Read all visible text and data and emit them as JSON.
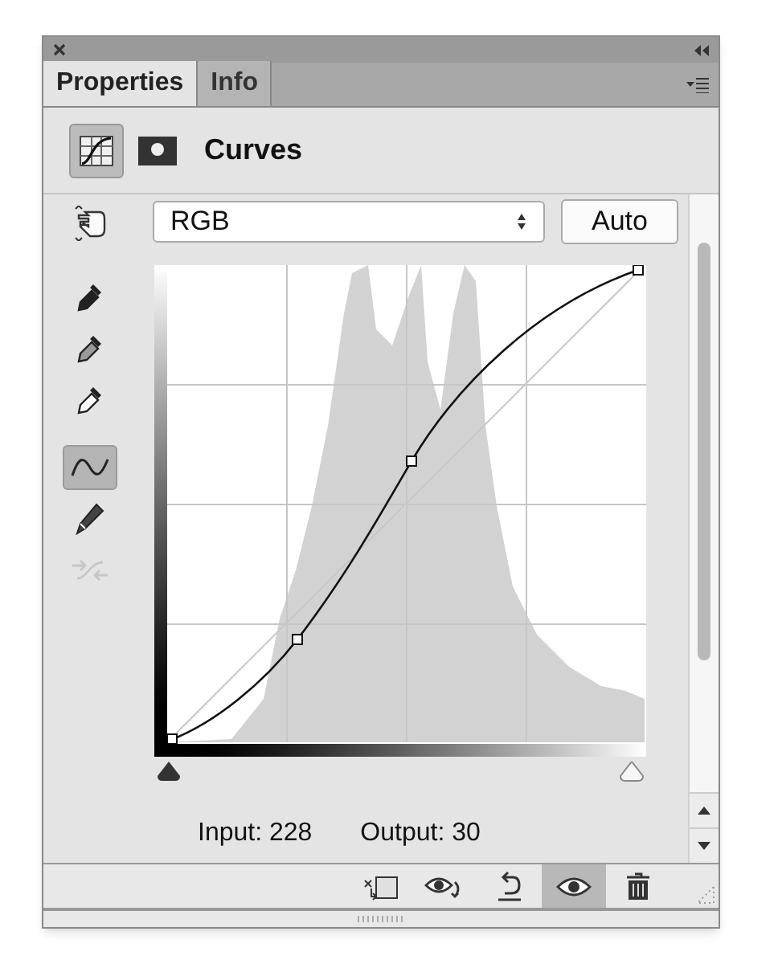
{
  "tabs": [
    {
      "label": "Properties",
      "selected": true
    },
    {
      "label": "Info",
      "selected": false
    }
  ],
  "header": {
    "title": "Curves",
    "icons": [
      {
        "kind": "adjustment",
        "selected": true
      },
      {
        "kind": "mask",
        "selected": false
      }
    ]
  },
  "channel": {
    "value": "RGB"
  },
  "auto_button": "Auto",
  "tools": [
    {
      "kind": "hand",
      "selected": false,
      "disabled": false
    },
    {
      "kind": "dropper-black",
      "selected": false,
      "disabled": false
    },
    {
      "kind": "dropper-gray",
      "selected": false,
      "disabled": false
    },
    {
      "kind": "dropper-white",
      "selected": false,
      "disabled": false
    },
    {
      "kind": "curve",
      "selected": true,
      "disabled": false
    },
    {
      "kind": "pencil",
      "selected": false,
      "disabled": false
    },
    {
      "kind": "smooth",
      "selected": false,
      "disabled": true
    }
  ],
  "readout": {
    "input": "Input: 228",
    "output": "Output: 30"
  },
  "footer_buttons": [
    {
      "kind": "clip",
      "selected": false
    },
    {
      "kind": "view-previous",
      "selected": false
    },
    {
      "kind": "reset",
      "selected": false
    },
    {
      "kind": "visibility",
      "selected": true
    },
    {
      "kind": "delete",
      "selected": false
    }
  ]
}
